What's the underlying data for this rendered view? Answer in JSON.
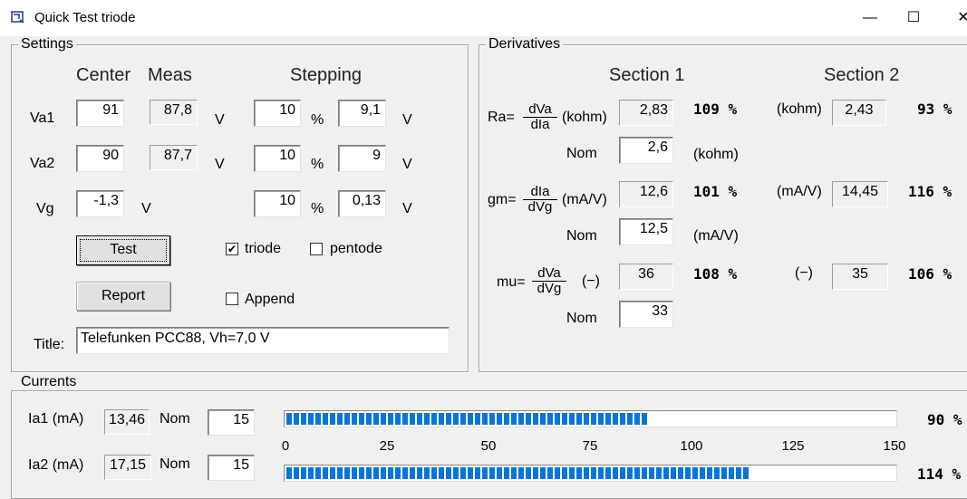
{
  "window": {
    "title": "Quick Test triode",
    "minimize_glyph": "—",
    "maximize_glyph": "☐",
    "close_glyph": "✕"
  },
  "settings": {
    "legend": "Settings",
    "col_center": "Center",
    "col_meas": "Meas",
    "col_stepping": "Stepping",
    "va1": {
      "label": "Va1",
      "center": "91",
      "meas": "87,8",
      "unit": "V",
      "step_pct": "10",
      "pct_sym": "%",
      "step_abs": "9,1",
      "step_unit": "V"
    },
    "va2": {
      "label": "Va2",
      "center": "90",
      "meas": "87,7",
      "unit": "V",
      "step_pct": "10",
      "pct_sym": "%",
      "step_abs": "9",
      "step_unit": "V"
    },
    "vg": {
      "label": "Vg",
      "center": "-1,3",
      "unit": "V",
      "step_pct": "10",
      "pct_sym": "%",
      "step_abs": "0,13",
      "step_unit": "V"
    },
    "test_button": "Test",
    "report_button": "Report",
    "triode": {
      "label": "triode",
      "checked": true
    },
    "pentode": {
      "label": "pentode",
      "checked": false
    },
    "append": {
      "label": "Append",
      "checked": false
    },
    "title_label": "Title:",
    "title_value": "Telefunken PCC88, Vh=7,0 V"
  },
  "derivatives": {
    "legend": "Derivatives",
    "section1": "Section 1",
    "section2": "Section 2",
    "ra": {
      "label": "Ra=",
      "num": "dVa",
      "den": "dIa",
      "unit1": "(kohm)",
      "val1": "2,83",
      "pct1": "109 %",
      "unit2": "(kohm)",
      "val2": "2,43",
      "pct2": "93 %",
      "nom_label": "Nom",
      "nom": "2,6",
      "nom_unit": "(kohm)"
    },
    "gm": {
      "label": "gm=",
      "num": "dIa",
      "den": "dVg",
      "unit1": "(mA/V)",
      "val1": "12,6",
      "pct1": "101 %",
      "unit2": "(mA/V)",
      "val2": "14,45",
      "pct2": "116 %",
      "nom_label": "Nom",
      "nom": "12,5",
      "nom_unit": "(mA/V)"
    },
    "mu": {
      "label": "mu=",
      "num": "dVa",
      "den": "dVg",
      "unit1": "(−)",
      "val1": "36",
      "pct1": "108 %",
      "unit2": "(−)",
      "val2": "35",
      "pct2": "106 %",
      "nom_label": "Nom",
      "nom": "33"
    }
  },
  "currents": {
    "legend": "Currents",
    "ia1": {
      "label": "Ia1 (mA)",
      "value": "13,46",
      "nom_label": "Nom",
      "nom": "15",
      "progress_value": 90,
      "pct": "90 %"
    },
    "ia2": {
      "label": "Ia2 (mA)",
      "value": "17,15",
      "nom_label": "Nom",
      "nom": "15",
      "progress_value": 114,
      "pct": "114 %"
    },
    "scale_max": 150,
    "ticks": [
      "0",
      "25",
      "50",
      "75",
      "100",
      "125",
      "150"
    ]
  }
}
